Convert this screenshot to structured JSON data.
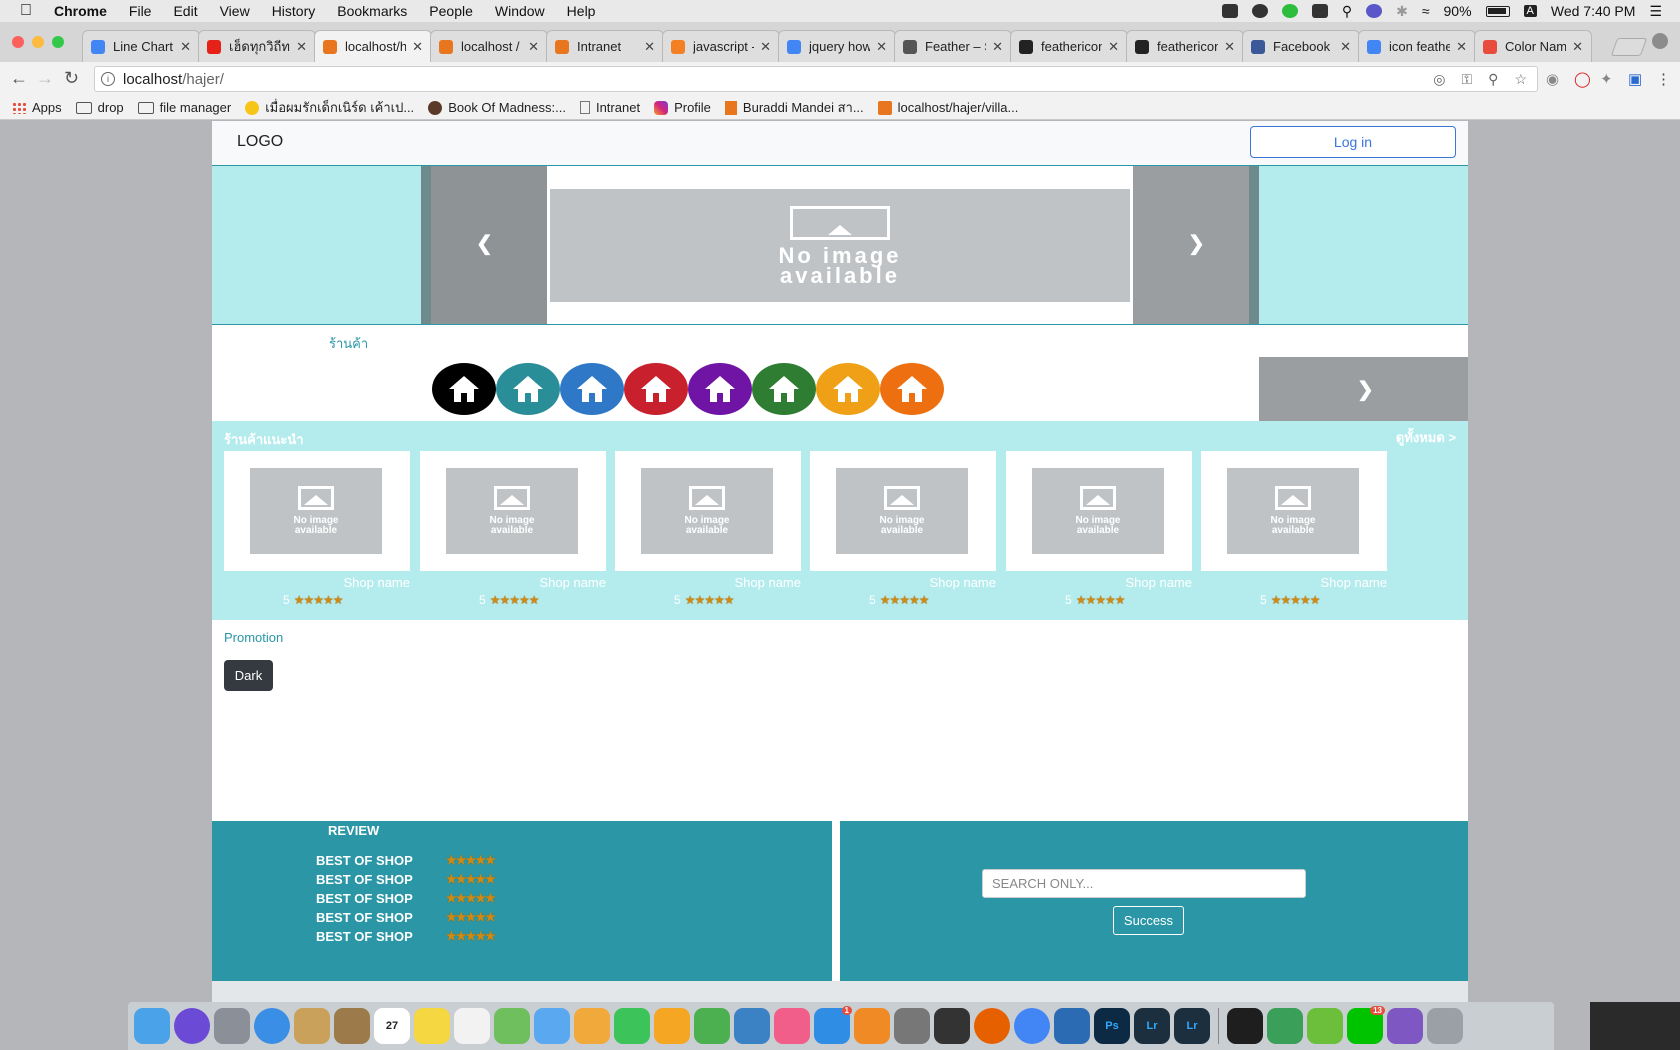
{
  "menubar": {
    "app": "Chrome",
    "items": [
      "File",
      "Edit",
      "View",
      "History",
      "Bookmarks",
      "People",
      "Window",
      "Help"
    ],
    "battery": "90%",
    "clock": "Wed 7:40 PM",
    "input_indicator": "A"
  },
  "tabs": [
    {
      "label": "Line Chart",
      "color": "#4285f4"
    },
    {
      "label": "เฮ็ดทุกวิถีทาง",
      "color": "#e62117"
    },
    {
      "label": "localhost/h",
      "color": "#e8761e"
    },
    {
      "label": "localhost /",
      "color": "#e8761e"
    },
    {
      "label": "Intranet",
      "color": "#e8761e"
    },
    {
      "label": "javascript -",
      "color": "#f48024"
    },
    {
      "label": "jquery how",
      "color": "#4285f4"
    },
    {
      "label": "Feather – S",
      "color": "#555555"
    },
    {
      "label": "feathericon",
      "color": "#222222"
    },
    {
      "label": "feathericon",
      "color": "#222222"
    },
    {
      "label": "Facebook",
      "color": "#3b5998"
    },
    {
      "label": "icon feathe",
      "color": "#4285f4"
    },
    {
      "label": "Color Name",
      "color": "#e74c3c"
    }
  ],
  "address": {
    "url_host": "localhost",
    "url_path": "/hajer/"
  },
  "bookmarks": [
    {
      "label": "Apps",
      "icon": "apps-grid-icon"
    },
    {
      "label": "drop",
      "icon": "folder-icon"
    },
    {
      "label": "file manager",
      "icon": "folder-icon"
    },
    {
      "label": "เมื่อผมรักเด็กเนิร์ด เค้าเป...",
      "icon": "emoji-icon"
    },
    {
      "label": "Book Of Madness:...",
      "icon": "avatar-icon"
    },
    {
      "label": "Intranet",
      "icon": "page-icon"
    },
    {
      "label": "Profile",
      "icon": "instagram-icon"
    },
    {
      "label": "Buraddi Mandei สา...",
      "icon": "bookmark-icon"
    },
    {
      "label": "localhost/hajer/villa...",
      "icon": "xampp-icon"
    }
  ],
  "site": {
    "logo": "LOGO",
    "login": "Log in",
    "banner_noimage": "No image available",
    "shops_label": "ร้านค้า",
    "shop_circle_colors": [
      "#000000",
      "#2a8e99",
      "#2e78c7",
      "#c8202c",
      "#7014a6",
      "#2e7d32",
      "#f0a016",
      "#ee6f10"
    ],
    "recommended_title": "ร้านค้าแนะนำ",
    "view_all": "ดูทั้งหมด >",
    "cards": [
      {
        "noimage": "No image available",
        "name": "Shop name",
        "rating": "5",
        "stars": "★★★★★"
      },
      {
        "noimage": "No image available",
        "name": "Shop name",
        "rating": "5",
        "stars": "★★★★★"
      },
      {
        "noimage": "No image available",
        "name": "Shop name",
        "rating": "5",
        "stars": "★★★★★"
      },
      {
        "noimage": "No image available",
        "name": "Shop name",
        "rating": "5",
        "stars": "★★★★★"
      },
      {
        "noimage": "No image available",
        "name": "Shop name",
        "rating": "5",
        "stars": "★★★★★"
      },
      {
        "noimage": "No image available",
        "name": "Shop name",
        "rating": "5",
        "stars": "★★★★★"
      }
    ],
    "promotion": "Promotion",
    "dark_button": "Dark",
    "review_title": "REVIEW",
    "reviews": [
      {
        "label": "BEST OF SHOP",
        "stars": "★★★★★"
      },
      {
        "label": "BEST OF SHOP",
        "stars": "★★★★★"
      },
      {
        "label": "BEST OF SHOP",
        "stars": "★★★★★"
      },
      {
        "label": "BEST OF SHOP",
        "stars": "★★★★★"
      },
      {
        "label": "BEST OF SHOP",
        "stars": "★★★★★"
      }
    ],
    "search_placeholder": "SEARCH ONLY...",
    "search_button": "Success"
  },
  "dock": {
    "apps": [
      {
        "name": "finder-icon",
        "color": "#4aa3e8"
      },
      {
        "name": "siri-icon",
        "color": "#6b4bd6"
      },
      {
        "name": "launchpad-icon",
        "color": "#8a8f98"
      },
      {
        "name": "safari-icon",
        "color": "#3a8ee6"
      },
      {
        "name": "mail-icon",
        "color": "#c9a15b"
      },
      {
        "name": "notes-folder-icon",
        "color": "#9c7a4a"
      },
      {
        "name": "calendar-icon",
        "color": "#ffffff"
      },
      {
        "name": "notes-icon",
        "color": "#f5d742"
      },
      {
        "name": "reminders-icon",
        "color": "#f2f2f2"
      },
      {
        "name": "maps-icon",
        "color": "#6fbf5f"
      },
      {
        "name": "messages-icon",
        "color": "#5aa9f0"
      },
      {
        "name": "photos-icon",
        "color": "#f2a93b"
      },
      {
        "name": "facetime-icon",
        "color": "#3cc45a"
      },
      {
        "name": "keynote-icon",
        "color": "#f5a623"
      },
      {
        "name": "numbers-icon",
        "color": "#4cb050"
      },
      {
        "name": "keynote2-icon",
        "color": "#3b82c4"
      },
      {
        "name": "itunes-icon",
        "color": "#f25e8a"
      },
      {
        "name": "app-store-icon",
        "color": "#2f8de4"
      },
      {
        "name": "ibooks-icon",
        "color": "#f08a24"
      },
      {
        "name": "system-preferences-icon",
        "color": "#777777"
      },
      {
        "name": "final-cut-icon",
        "color": "#333333"
      },
      {
        "name": "firefox-icon",
        "color": "#e66000"
      },
      {
        "name": "chrome-icon",
        "color": "#4285f4"
      },
      {
        "name": "mysql-workbench-icon",
        "color": "#2a6bb3"
      },
      {
        "name": "photoshop-icon",
        "color": "#0c2a44"
      },
      {
        "name": "lightroom-icon",
        "color": "#1c2f3f"
      },
      {
        "name": "lightroom-classic-icon",
        "color": "#1c2f3f"
      },
      {
        "name": "terminal-icon",
        "color": "#1e1e1e"
      },
      {
        "name": "android-studio-icon",
        "color": "#3a9f58"
      },
      {
        "name": "leaf-icon",
        "color": "#6cbf3a"
      },
      {
        "name": "line-icon",
        "color": "#00c300"
      },
      {
        "name": "github-desktop-icon",
        "color": "#7e57c2"
      },
      {
        "name": "settings-icon",
        "color": "#9aa0a6"
      }
    ],
    "calendar_day": "27",
    "badges": {
      "app_store": "1",
      "line": "13"
    },
    "ps_label": "Ps",
    "lr_label": "Lr"
  }
}
